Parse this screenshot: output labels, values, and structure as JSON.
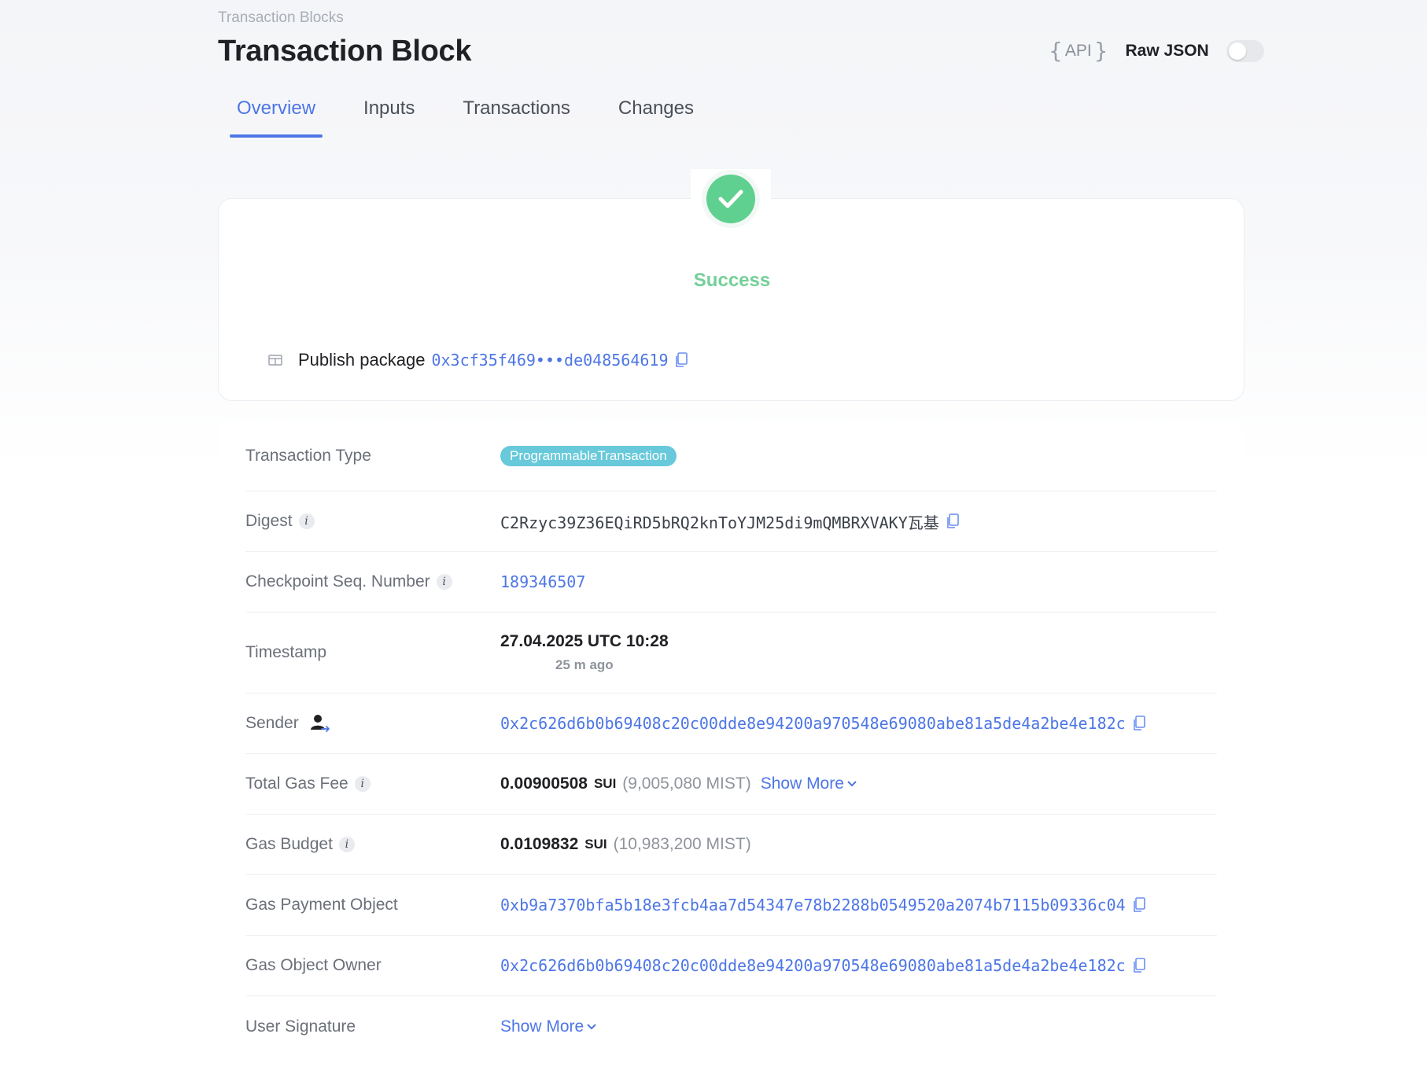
{
  "breadcrumb": "Transaction Blocks",
  "title": "Transaction Block",
  "header": {
    "api_label": "API",
    "raw_json_label": "Raw JSON",
    "raw_json_enabled": false
  },
  "tabs": [
    {
      "label": "Overview",
      "active": true
    },
    {
      "label": "Inputs",
      "active": false
    },
    {
      "label": "Transactions",
      "active": false
    },
    {
      "label": "Changes",
      "active": false
    }
  ],
  "status": {
    "icon": "check-icon",
    "text": "Success",
    "color": "#5fd08f"
  },
  "publish": {
    "label": "Publish package",
    "package_id": "0x3cf35f469•••de048564619"
  },
  "details": {
    "transaction_type": {
      "label": "Transaction Type",
      "value": "ProgrammableTransaction"
    },
    "digest": {
      "label": "Digest",
      "value": "C2Rzyc39Z36EQiRD5bRQ2knToYJM25di9mQMBRXVAKY瓦基"
    },
    "checkpoint": {
      "label": "Checkpoint Seq. Number",
      "value": "189346507"
    },
    "timestamp": {
      "label": "Timestamp",
      "value": "27.04.2025 UTC 10:28",
      "relative": "25 m ago"
    },
    "sender": {
      "label": "Sender",
      "value": "0x2c626d6b0b69408c20c00dde8e94200a970548e69080abe81a5de4a2be4e182c"
    },
    "total_gas_fee": {
      "label": "Total Gas Fee",
      "amount": "0.00900508",
      "unit": "SUI",
      "mist": "(9,005,080 MIST)",
      "show_more": "Show More"
    },
    "gas_budget": {
      "label": "Gas Budget",
      "amount": "0.0109832",
      "unit": "SUI",
      "mist": "(10,983,200 MIST)"
    },
    "gas_payment_object": {
      "label": "Gas Payment Object",
      "value": "0xb9a7370bfa5b18e3fcb4aa7d54347e78b2288b0549520a2074b7115b09336c04"
    },
    "gas_object_owner": {
      "label": "Gas Object Owner",
      "value": "0x2c626d6b0b69408c20c00dde8e94200a970548e69080abe81a5de4a2be4e182c"
    },
    "user_signature": {
      "label": "User Signature",
      "show_more": "Show More"
    }
  },
  "colors": {
    "accent": "#4d76e6",
    "success": "#74cf99",
    "pill": "#67c9da"
  }
}
